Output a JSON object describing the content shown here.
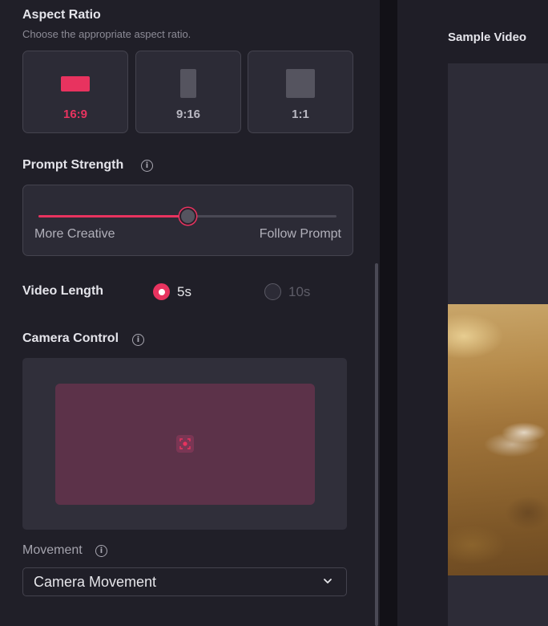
{
  "aspect_ratio": {
    "title": "Aspect Ratio",
    "subtitle": "Choose the appropriate aspect ratio.",
    "options": [
      {
        "label": "16:9",
        "selected": true
      },
      {
        "label": "9:16",
        "selected": false
      },
      {
        "label": "1:1",
        "selected": false
      }
    ]
  },
  "prompt_strength": {
    "title": "Prompt Strength",
    "info_icon": "info-icon",
    "min_label": "More Creative",
    "max_label": "Follow Prompt",
    "value_fraction": 0.5
  },
  "video_length": {
    "title": "Video Length",
    "options": [
      {
        "label": "5s",
        "selected": true
      },
      {
        "label": "10s",
        "selected": false
      }
    ]
  },
  "camera_control": {
    "title": "Camera Control",
    "info_icon": "info-icon",
    "center_icon": "focus-target-icon"
  },
  "movement": {
    "label": "Movement",
    "info_icon": "info-icon",
    "selected": "Camera Movement",
    "chevron_icon": "chevron-down-icon"
  },
  "preview": {
    "title": "Sample Video"
  },
  "colors": {
    "accent": "#e8335f",
    "panel_bg": "#201f28",
    "card_bg": "#2c2b36",
    "camera_pad": "#5c3249"
  }
}
